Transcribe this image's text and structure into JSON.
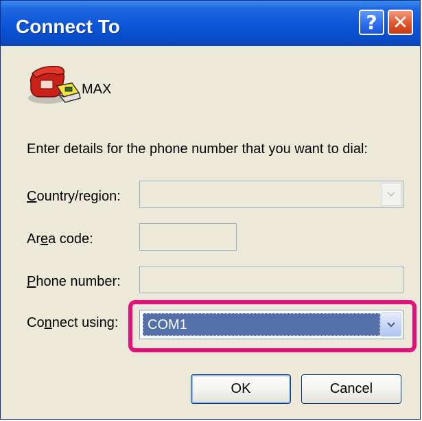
{
  "window": {
    "title": "Connect To",
    "help_glyph": "?",
    "close_glyph": "✕"
  },
  "connection": {
    "name": "MAX",
    "icon": "phone-connection-icon"
  },
  "instructions": "Enter details for the phone number that you want to dial:",
  "fields": {
    "country_label_ul": "C",
    "country_label_rest": "ountry/region:",
    "country_value": "",
    "area_label_a": "Ar",
    "area_label_ul": "e",
    "area_label_rest": "a code:",
    "area_value": "",
    "phone_label_ul": "P",
    "phone_label_rest": "hone number:",
    "phone_value": "",
    "connect_label_a": "Co",
    "connect_label_ul": "n",
    "connect_label_rest": "nect using:",
    "connect_value": "COM1"
  },
  "buttons": {
    "ok": "OK",
    "cancel": "Cancel"
  },
  "colors": {
    "titlebar": "#0b55d8",
    "highlight": "#e2117b",
    "selection": "#5470a8"
  }
}
